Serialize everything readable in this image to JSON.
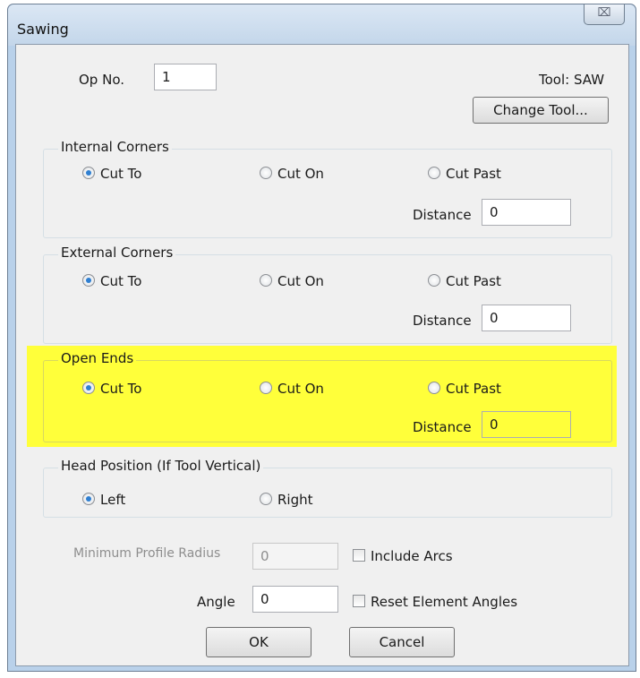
{
  "window": {
    "title": "Sawing",
    "close_glyph": "⌧"
  },
  "op": {
    "label": "Op No.",
    "value": "1"
  },
  "tool": {
    "label": "Tool: SAW",
    "change_button": "Change Tool..."
  },
  "groups": {
    "internal": {
      "title": "Internal Corners",
      "opt1": "Cut To",
      "opt2": "Cut On",
      "opt3": "Cut Past",
      "distance_label": "Distance",
      "distance_value": "0",
      "selected": "Cut To"
    },
    "external": {
      "title": "External Corners",
      "opt1": "Cut To",
      "opt2": "Cut On",
      "opt3": "Cut Past",
      "distance_label": "Distance",
      "distance_value": "0",
      "selected": "Cut To"
    },
    "open": {
      "title": "Open Ends",
      "opt1": "Cut To",
      "opt2": "Cut On",
      "opt3": "Cut Past",
      "distance_label": "Distance",
      "distance_value": "0",
      "selected": "Cut To",
      "highlight_color": "#ffff3a"
    },
    "head": {
      "title": "Head Position (If Tool Vertical)",
      "opt1": "Left",
      "opt2": "Right",
      "selected": "Left"
    }
  },
  "min_radius": {
    "label": "Minimum Profile Radius",
    "value": "0"
  },
  "include_arcs": {
    "label": "Include Arcs",
    "checked": false
  },
  "angle": {
    "label": "Angle",
    "value": "0"
  },
  "reset_angles": {
    "label": "Reset Element Angles",
    "checked": false
  },
  "buttons": {
    "ok": "OK",
    "cancel": "Cancel"
  }
}
